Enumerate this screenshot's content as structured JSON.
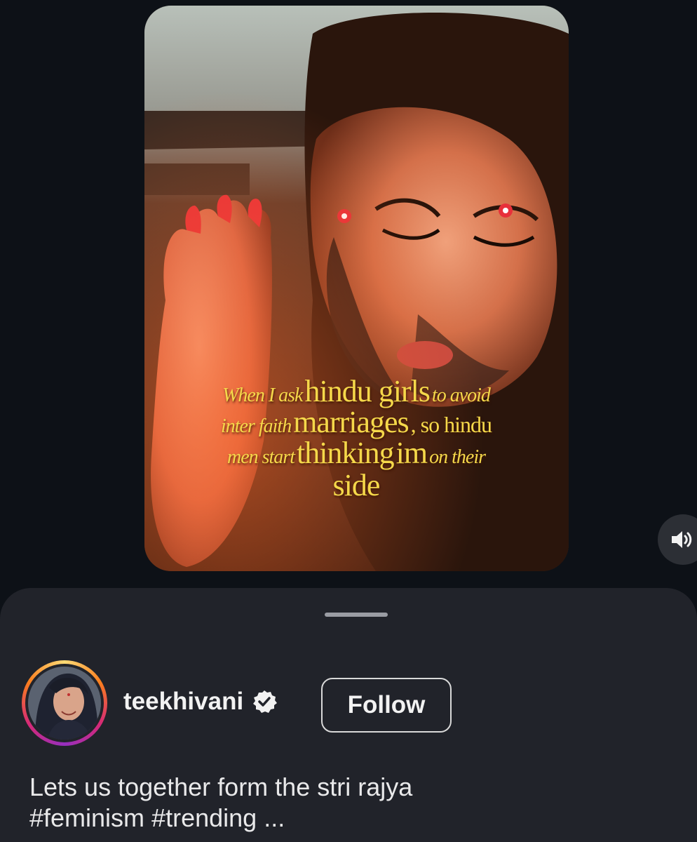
{
  "video": {
    "overlay_caption": {
      "line1": [
        "When I ask",
        "hindu girls",
        "to avoid"
      ],
      "line2": [
        "inter faith",
        "marriages",
        ", so hindu"
      ],
      "line3": [
        "men start",
        "thinking",
        "im",
        "on their"
      ],
      "line4": "side"
    },
    "mute_icon": "speaker-volume-icon"
  },
  "post": {
    "username": "teekhivani",
    "verified_icon": "verified-badge-icon",
    "follow_label": "Follow",
    "caption_line1": "Lets us together form the stri rajya",
    "hashtag1": "#feminism",
    "hashtag2": "#trending",
    "more": "..."
  },
  "colors": {
    "background": "#0d1117",
    "sheet": "#21232a",
    "overlay_text": "#f5d84a"
  }
}
